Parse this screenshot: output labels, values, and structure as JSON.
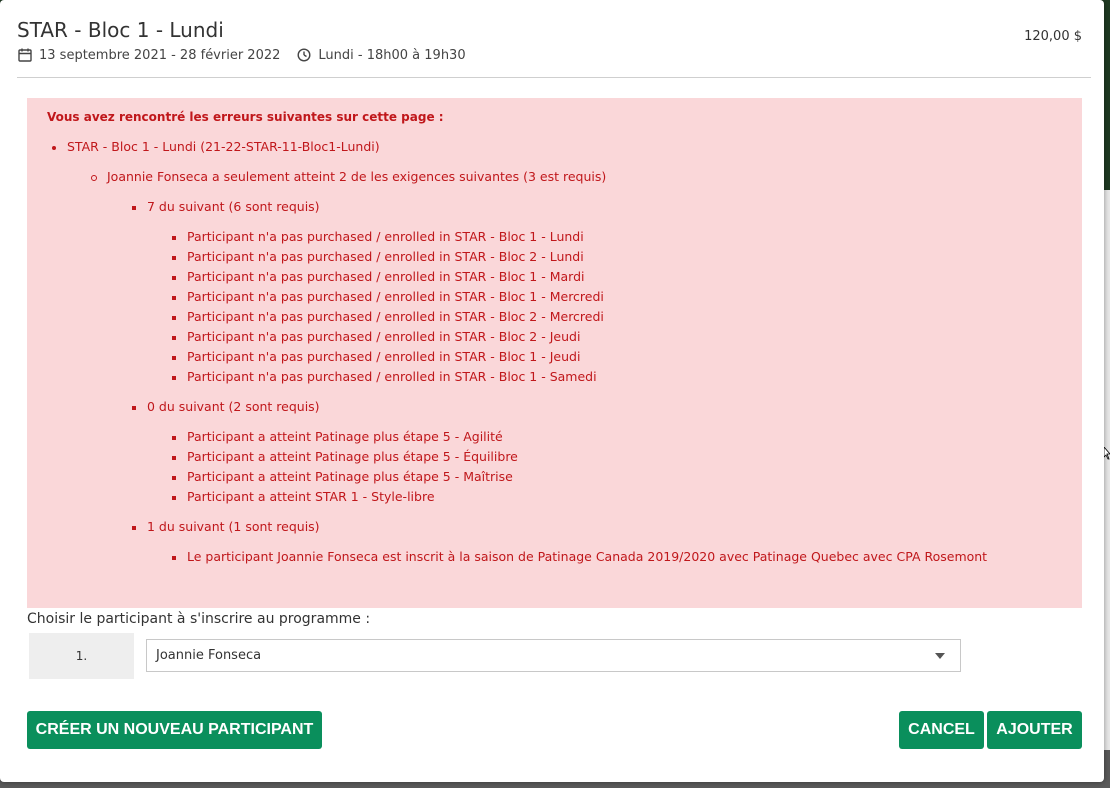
{
  "modal": {
    "title": "STAR - Bloc 1 - Lundi",
    "price": "120,00 $",
    "date_range": "13 septembre 2021 - 28 février 2022",
    "schedule": "Lundi - 18h00 à 19h30"
  },
  "errors": {
    "heading": "Vous avez rencontré les erreurs suivantes sur cette page :",
    "program": "STAR - Bloc 1 - Lundi (21-22-STAR-11-Bloc1-Lundi)",
    "summary": "Joannie Fonseca a seulement atteint 2 de les exigences suivantes (3 est requis)",
    "groups": [
      {
        "label": "7 du suivant (6 sont requis)",
        "items": [
          "Participant n'a pas purchased / enrolled in STAR - Bloc 1 - Lundi",
          "Participant n'a pas purchased / enrolled in STAR - Bloc 2 - Lundi",
          "Participant n'a pas purchased / enrolled in STAR - Bloc 1 - Mardi",
          "Participant n'a pas purchased / enrolled in STAR - Bloc 1 - Mercredi",
          "Participant n'a pas purchased / enrolled in STAR - Bloc 2 - Mercredi",
          "Participant n'a pas purchased / enrolled in STAR - Bloc 2 - Jeudi",
          "Participant n'a pas purchased / enrolled in STAR - Bloc 1 - Jeudi",
          "Participant n'a pas purchased / enrolled in STAR - Bloc 1 - Samedi"
        ]
      },
      {
        "label": "0 du suivant (2 sont requis)",
        "items": [
          "Participant a atteint Patinage plus étape 5 - Agilité",
          "Participant a atteint Patinage plus étape 5 - Équilibre",
          "Participant a atteint Patinage plus étape 5 - Maîtrise",
          "Participant a atteint STAR 1 - Style-libre"
        ]
      },
      {
        "label": "1 du suivant (1 sont requis)",
        "items": [
          "Le participant Joannie Fonseca est inscrit à la saison de Patinage Canada 2019/2020 avec Patinage Quebec avec CPA Rosemont"
        ]
      }
    ]
  },
  "participant": {
    "label": "Choisir le participant à s'inscrire au programme :",
    "row_number": "1.",
    "selected": "Joannie Fonseca"
  },
  "buttons": {
    "create": "CRÉER UN NOUVEAU PARTICIPANT",
    "cancel": "CANCEL",
    "add": "AJOUTER"
  },
  "colors": {
    "accent": "#0a8f5c",
    "error_bg": "#fad7d9",
    "error_text": "#c0171b"
  }
}
